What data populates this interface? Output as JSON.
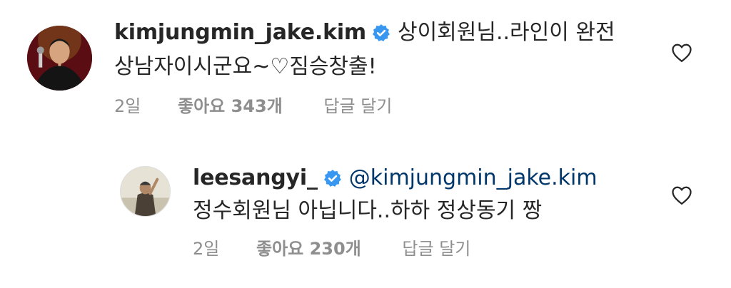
{
  "comments": [
    {
      "username": "kimjungmin_jake.kim",
      "verified_icon": "verified-badge-icon",
      "text_line1": "상이회원님..라인이 완전",
      "text_line2": "상남자이시군요~♡짐승창출!",
      "time": "2일",
      "likes": "좋아요 343개",
      "reply_label": "답글 달기",
      "like_icon": "heart-outline-icon"
    },
    {
      "username": "leesangyi_",
      "verified_icon": "verified-badge-icon",
      "mention": "@kimjungmin_jake.kim",
      "text_line2": "정수회원님 아닙니다..하하 정상동기 짱",
      "time": "2일",
      "likes": "좋아요 230개",
      "reply_label": "답글 달기",
      "like_icon": "heart-outline-icon"
    }
  ],
  "colors": {
    "text": "#262626",
    "meta": "#8e8e8e",
    "verified": "#3897f0",
    "mention": "#00376b"
  }
}
